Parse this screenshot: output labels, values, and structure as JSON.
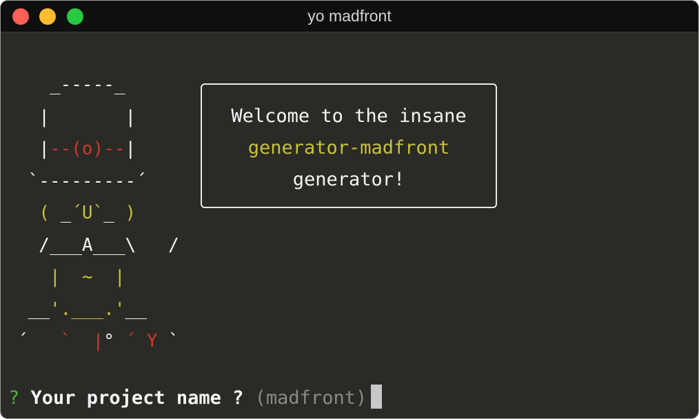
{
  "window": {
    "title": "yo madfront",
    "traffic_lights": {
      "close_color": "#fe5f57",
      "minimize_color": "#febc2e",
      "zoom_color": "#28c840"
    }
  },
  "colors": {
    "background": "#2a2b26",
    "text": "#f4f4f4",
    "red": "#d0382d",
    "yellow": "#c9c13c",
    "green": "#4fb33a",
    "muted": "#8a8a8a",
    "cursor": "#c8c8c8"
  },
  "ascii_art": {
    "lines": [
      [
        {
          "t": "   _-----_",
          "c": "text"
        }
      ],
      [
        {
          "t": "  |       |",
          "c": "text"
        }
      ],
      [
        {
          "t": "  |",
          "c": "text"
        },
        {
          "t": "--(o)--",
          "c": "red"
        },
        {
          "t": "|",
          "c": "text"
        }
      ],
      [
        {
          "t": " `---------´",
          "c": "text"
        }
      ],
      [
        {
          "t": "  ",
          "c": "text"
        },
        {
          "t": "( ",
          "c": "yellow"
        },
        {
          "t": "_",
          "c": "text"
        },
        {
          "t": "´U`",
          "c": "yellow"
        },
        {
          "t": "_",
          "c": "text"
        },
        {
          "t": " )",
          "c": "yellow"
        }
      ],
      [
        {
          "t": "  /___A___\\   /",
          "c": "text"
        }
      ],
      [
        {
          "t": "   ",
          "c": "text"
        },
        {
          "t": "|  ~  |",
          "c": "yellow"
        }
      ],
      [
        {
          "t": " __",
          "c": "text"
        },
        {
          "t": "'.___.'",
          "c": "yellow"
        },
        {
          "t": "__",
          "c": "text"
        }
      ],
      [
        {
          "t": "´   ",
          "c": "text"
        },
        {
          "t": "`",
          "c": "red"
        },
        {
          "t": "  ",
          "c": "text"
        },
        {
          "t": "|",
          "c": "red"
        },
        {
          "t": "° ",
          "c": "text"
        },
        {
          "t": "´ Y",
          "c": "red"
        },
        {
          "t": " `",
          "c": "text"
        }
      ]
    ]
  },
  "welcome_box": {
    "line1": "Welcome to the insane",
    "line2": "generator-madfront",
    "line3": "generator!"
  },
  "prompt": {
    "marker": "?",
    "question": "Your project name ?",
    "default_value": "(madfront)"
  }
}
